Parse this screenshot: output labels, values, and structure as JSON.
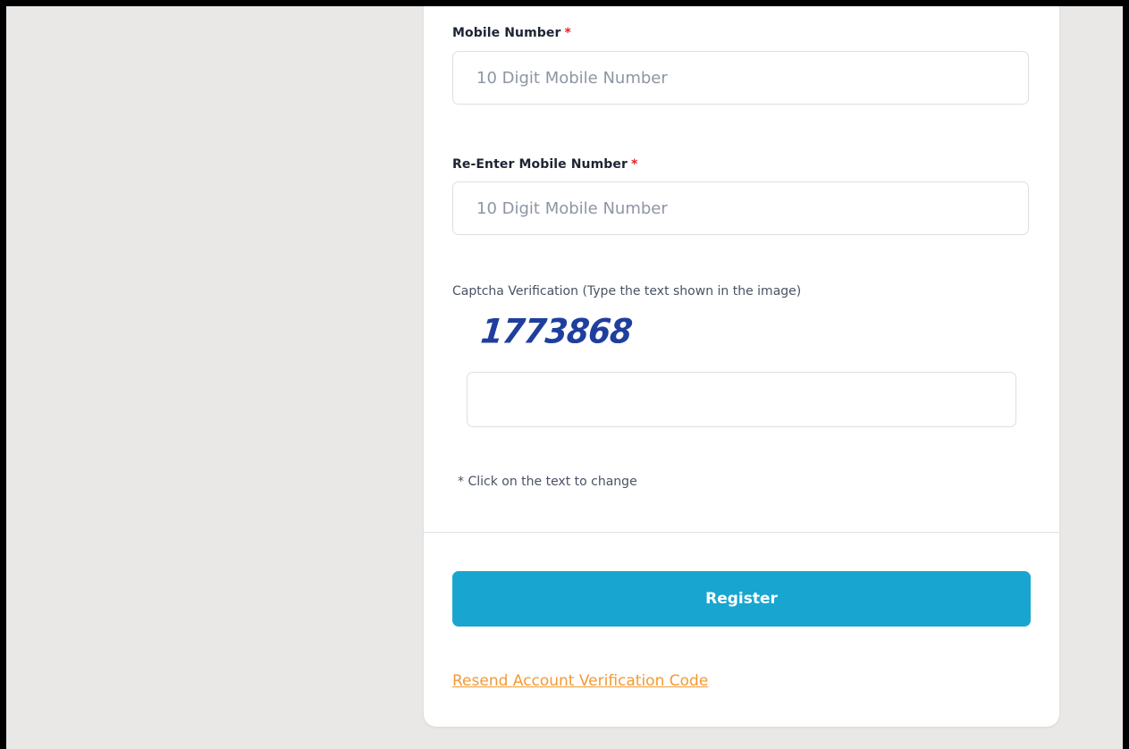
{
  "form": {
    "mobile": {
      "label": "Mobile Number",
      "required_mark": "*",
      "placeholder": "10 Digit Mobile Number",
      "value": ""
    },
    "reenter_mobile": {
      "label": "Re-Enter Mobile Number",
      "required_mark": "*",
      "placeholder": "10 Digit Mobile Number",
      "value": ""
    },
    "captcha": {
      "label": "Captcha Verification (Type the text shown in the image)",
      "image_text": "1773868",
      "input_value": "",
      "hint": "* Click on the text to change"
    },
    "register_label": "Register",
    "resend_link_label": "Resend Account Verification Code"
  },
  "colors": {
    "page_background": "#e9e8e6",
    "card_background": "#ffffff",
    "primary_button": "#18a6d0",
    "link": "#f29a33",
    "required": "#e02424",
    "captcha_text": "#1f3f9e"
  }
}
